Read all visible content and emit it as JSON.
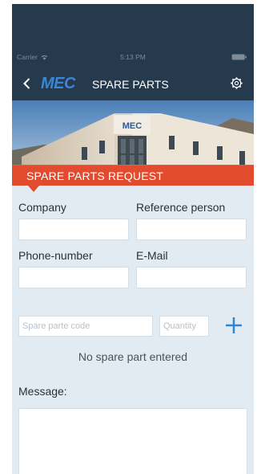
{
  "status_bar": {
    "carrier": "Carrier",
    "time": "5:13 PM"
  },
  "nav": {
    "logo_text": "MEC",
    "title": "SPARE PARTS"
  },
  "banner": {
    "building_sign": "MEC"
  },
  "section": {
    "title": "SPARE PARTS REQUEST"
  },
  "form": {
    "company_label": "Company",
    "reference_label": "Reference person",
    "phone_label": "Phone-number",
    "email_label": "E-Mail",
    "spare_code_placeholder": "Spare parte code",
    "quantity_placeholder": "Quantity",
    "empty_message": "No spare part entered",
    "message_label": "Message:"
  },
  "colors": {
    "nav_bg": "#263a4d",
    "accent_red": "#e34b2e",
    "accent_blue": "#2f86d1",
    "form_bg": "#e3ebf2"
  },
  "icons": {
    "back": "back-chevron-icon",
    "settings": "gear-icon",
    "add": "plus-icon",
    "wifi": "wifi-icon",
    "battery": "battery-icon"
  }
}
